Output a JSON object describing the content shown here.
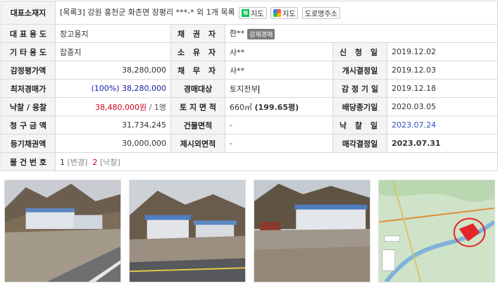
{
  "rows": {
    "r1": {
      "label": "대표소재지",
      "prefix": "[목록3]",
      "address": "강원 홍천군 화촌면 장평리 ***-*",
      "extra": "외 1개 목록",
      "naver_btn": "지도",
      "daum_btn": "지도",
      "road_btn": "도로명주소"
    },
    "r2": {
      "l1": "대 표 용 도",
      "v1": "창고용지",
      "l2": "채 권 자",
      "v2": "한**",
      "badge": "강제경매"
    },
    "r3": {
      "l1": "기 타 용 도",
      "v1": "잡종지",
      "l2": "소 유 자",
      "v2": "사**",
      "l3": "신 청 일",
      "v3": "2019.12.02"
    },
    "r4": {
      "l1": "감정평가액",
      "v1": "38,280,000",
      "l2": "채 무 자",
      "v2": "사**",
      "l3": "개시결정일",
      "v3": "2019.12.03"
    },
    "r5": {
      "l1": "최저경매가",
      "v1a": "(100%)",
      "v1b": "38,280,000",
      "l2": "경매대상",
      "v2": "토지전부",
      "l3": "감 정 기 일",
      "v3": "2019.12.18"
    },
    "r6": {
      "l1": "낙찰 / 응찰",
      "v1a": "38,480,000원",
      "v1b": "/ 1명",
      "l2": "토 지 면 적",
      "v2a": "660㎡",
      "v2b": "(199.65평)",
      "l3": "배당종기일",
      "v3": "2020.03.05"
    },
    "r7": {
      "l1": "청 구 금 액",
      "v1": "31,734,245",
      "l2": "건물면적",
      "v2": "-",
      "l3": "낙 찰 일",
      "v3": "2023.07.24"
    },
    "r8": {
      "l1": "등기채권액",
      "v1": "30,000,000",
      "l2": "제시외면적",
      "v2": "-",
      "l3": "매각결정일",
      "v3": "2023.07.31"
    },
    "r9": {
      "l1": "물 건 번 호",
      "n1": "1",
      "t1": "[변경]",
      "n2": "2",
      "t2": "[낙찰]"
    }
  },
  "colors": {
    "label_bg": "#f4f4f4",
    "border": "#d9d9d9",
    "red": "#d0021b",
    "blue": "#1a1aa6",
    "naver": "#03c75a"
  }
}
